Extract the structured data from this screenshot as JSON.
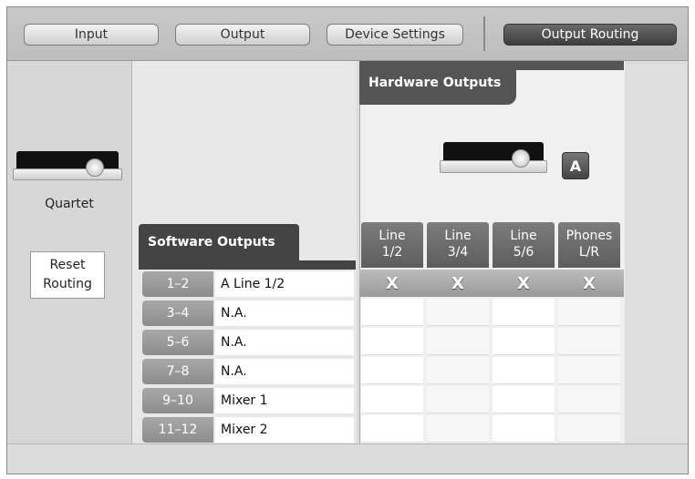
{
  "tabs": [
    {
      "label": "Input"
    },
    {
      "label": "Output"
    },
    {
      "label": "Device Settings"
    },
    {
      "label": "Output Routing",
      "active": true
    }
  ],
  "device": {
    "name": "Quartet",
    "icon": "audio-interface-icon"
  },
  "reset_button": {
    "label_line1": "Reset",
    "label_line2": "Routing"
  },
  "software_outputs": {
    "title": "Software Outputs",
    "rows": [
      {
        "channels": "1–2",
        "assignment": "A Line 1/2"
      },
      {
        "channels": "3–4",
        "assignment": "N.A."
      },
      {
        "channels": "5–6",
        "assignment": "N.A."
      },
      {
        "channels": "7–8",
        "assignment": "N.A."
      },
      {
        "channels": "9–10",
        "assignment": "Mixer 1"
      },
      {
        "channels": "11–12",
        "assignment": "Mixer 2"
      }
    ]
  },
  "hardware_outputs": {
    "title": "Hardware Outputs",
    "badge": "A",
    "columns": [
      {
        "line1": "Line",
        "line2": "1/2"
      },
      {
        "line1": "Line",
        "line2": "3/4"
      },
      {
        "line1": "Line",
        "line2": "5/6"
      },
      {
        "line1": "Phones",
        "line2": "L/R"
      }
    ],
    "selected_row_marks": [
      "X",
      "X",
      "X",
      "X"
    ]
  },
  "colors": {
    "active_tab": "#4a4a4a",
    "header_dark": "#444444",
    "channel_cell": "#9a9a9a"
  }
}
